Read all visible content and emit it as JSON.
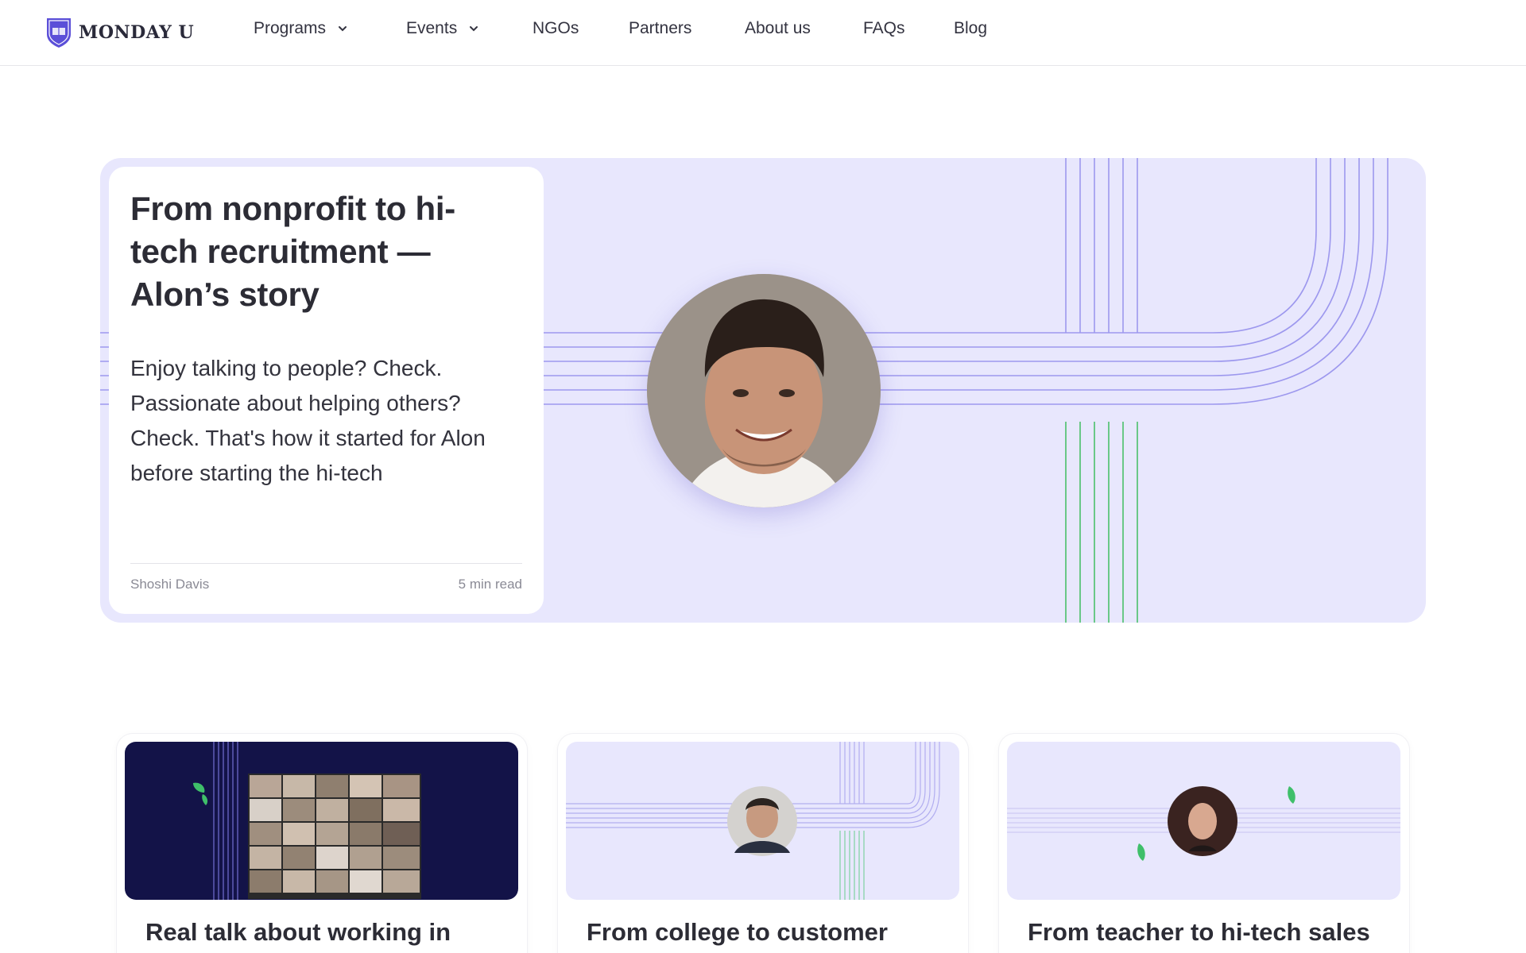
{
  "brand": {
    "name": "MONDAY U",
    "accent": "#5b4fd8"
  },
  "nav": {
    "items": [
      {
        "label": "Programs",
        "dropdown": true
      },
      {
        "label": "Events",
        "dropdown": true
      },
      {
        "label": "NGOs",
        "dropdown": false
      },
      {
        "label": "Partners",
        "dropdown": false
      },
      {
        "label": "About us",
        "dropdown": false
      },
      {
        "label": "FAQs",
        "dropdown": false
      },
      {
        "label": "Blog",
        "dropdown": false
      }
    ]
  },
  "hero": {
    "title": "From nonprofit to hi-tech recruitment — Alon’s story",
    "excerpt": "Enjoy talking to people? Check. Passionate about helping others? Check. That's how it started for Alon before starting the hi-tech",
    "author": "Shoshi Davis",
    "read_time": "5 min read",
    "bg_color": "#e8e7fd",
    "line_color": "#9d98ee",
    "green_line_color": "#5cc47a"
  },
  "cards": [
    {
      "title": "Real talk about working in"
    },
    {
      "title": "From college to customer"
    },
    {
      "title": "From teacher to hi-tech sales"
    }
  ]
}
